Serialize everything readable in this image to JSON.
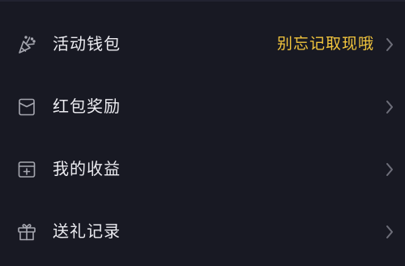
{
  "colors": {
    "background": "#181923",
    "text": "#ececf1",
    "hint": "#f2c53d",
    "icon": "#a6a7b0",
    "chevron": "#6e6f7a"
  },
  "menu": {
    "items": [
      {
        "label": "活动钱包",
        "hint": "别忘记取现哦",
        "icon": "party-popper-icon"
      },
      {
        "label": "红包奖励",
        "icon": "red-envelope-icon"
      },
      {
        "label": "我的收益",
        "icon": "income-box-icon"
      },
      {
        "label": "送礼记录",
        "icon": "gift-icon"
      }
    ]
  }
}
